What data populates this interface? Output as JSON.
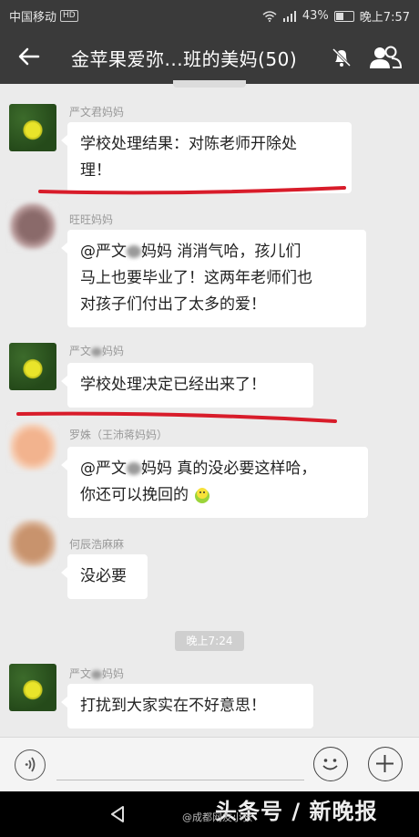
{
  "status_bar": {
    "carrier": "中国移动",
    "network_badge": "HD",
    "battery": "43%",
    "time": "晚上7:57"
  },
  "header": {
    "title": "金苹果爱弥...班的美妈(50)",
    "back_icon": "back-arrow-icon",
    "mute_icon": "bell-muted-icon",
    "members_icon": "group-members-icon"
  },
  "messages": [
    {
      "sender": "严文君妈妈",
      "lines": [
        "学校处理结果：对陈老师开除处",
        "理！"
      ],
      "avatar": "leaf"
    },
    {
      "sender": "旺旺妈妈",
      "lines_parts": {
        "l1a": "@严文",
        "l1b": "妈妈  消消气哈，孩儿们"
      },
      "lines": [
        "马上也要毕业了！这两年老师们也",
        "对孩子们付出了太多的爱！"
      ],
      "avatar": "blur-brown"
    },
    {
      "sender_parts": {
        "a": "严文",
        "b": "妈妈"
      },
      "lines": [
        "学校处理决定已经出来了！"
      ],
      "avatar": "leaf"
    },
    {
      "sender": "罗姝（王沛蒋妈妈）",
      "lines_parts": {
        "l1a": "@严文",
        "l1b": "妈妈  真的没必要这样哈，",
        "l2": "你还可以挽回的"
      },
      "avatar": "blur-peach"
    },
    {
      "sender": "何辰浩麻麻",
      "lines": [
        "没必要"
      ],
      "avatar": "blur-tan"
    },
    {
      "sender_parts": {
        "a": "严文",
        "b": "妈妈"
      },
      "lines": [
        "打扰到大家实在不好意思！"
      ],
      "avatar": "leaf"
    }
  ],
  "time_divider": "晚上7:24",
  "input_bar": {
    "voice_icon": "voice-icon",
    "emoji_icon": "emoji-icon",
    "plus_icon": "plus-icon"
  },
  "watermark": {
    "small": "@成都网友小张",
    "big": "头条号 / 新晚报"
  },
  "colors": {
    "header_bg": "#3a3a3a",
    "chat_bg": "#ebebeb",
    "annotation_red": "#d81c2a"
  }
}
